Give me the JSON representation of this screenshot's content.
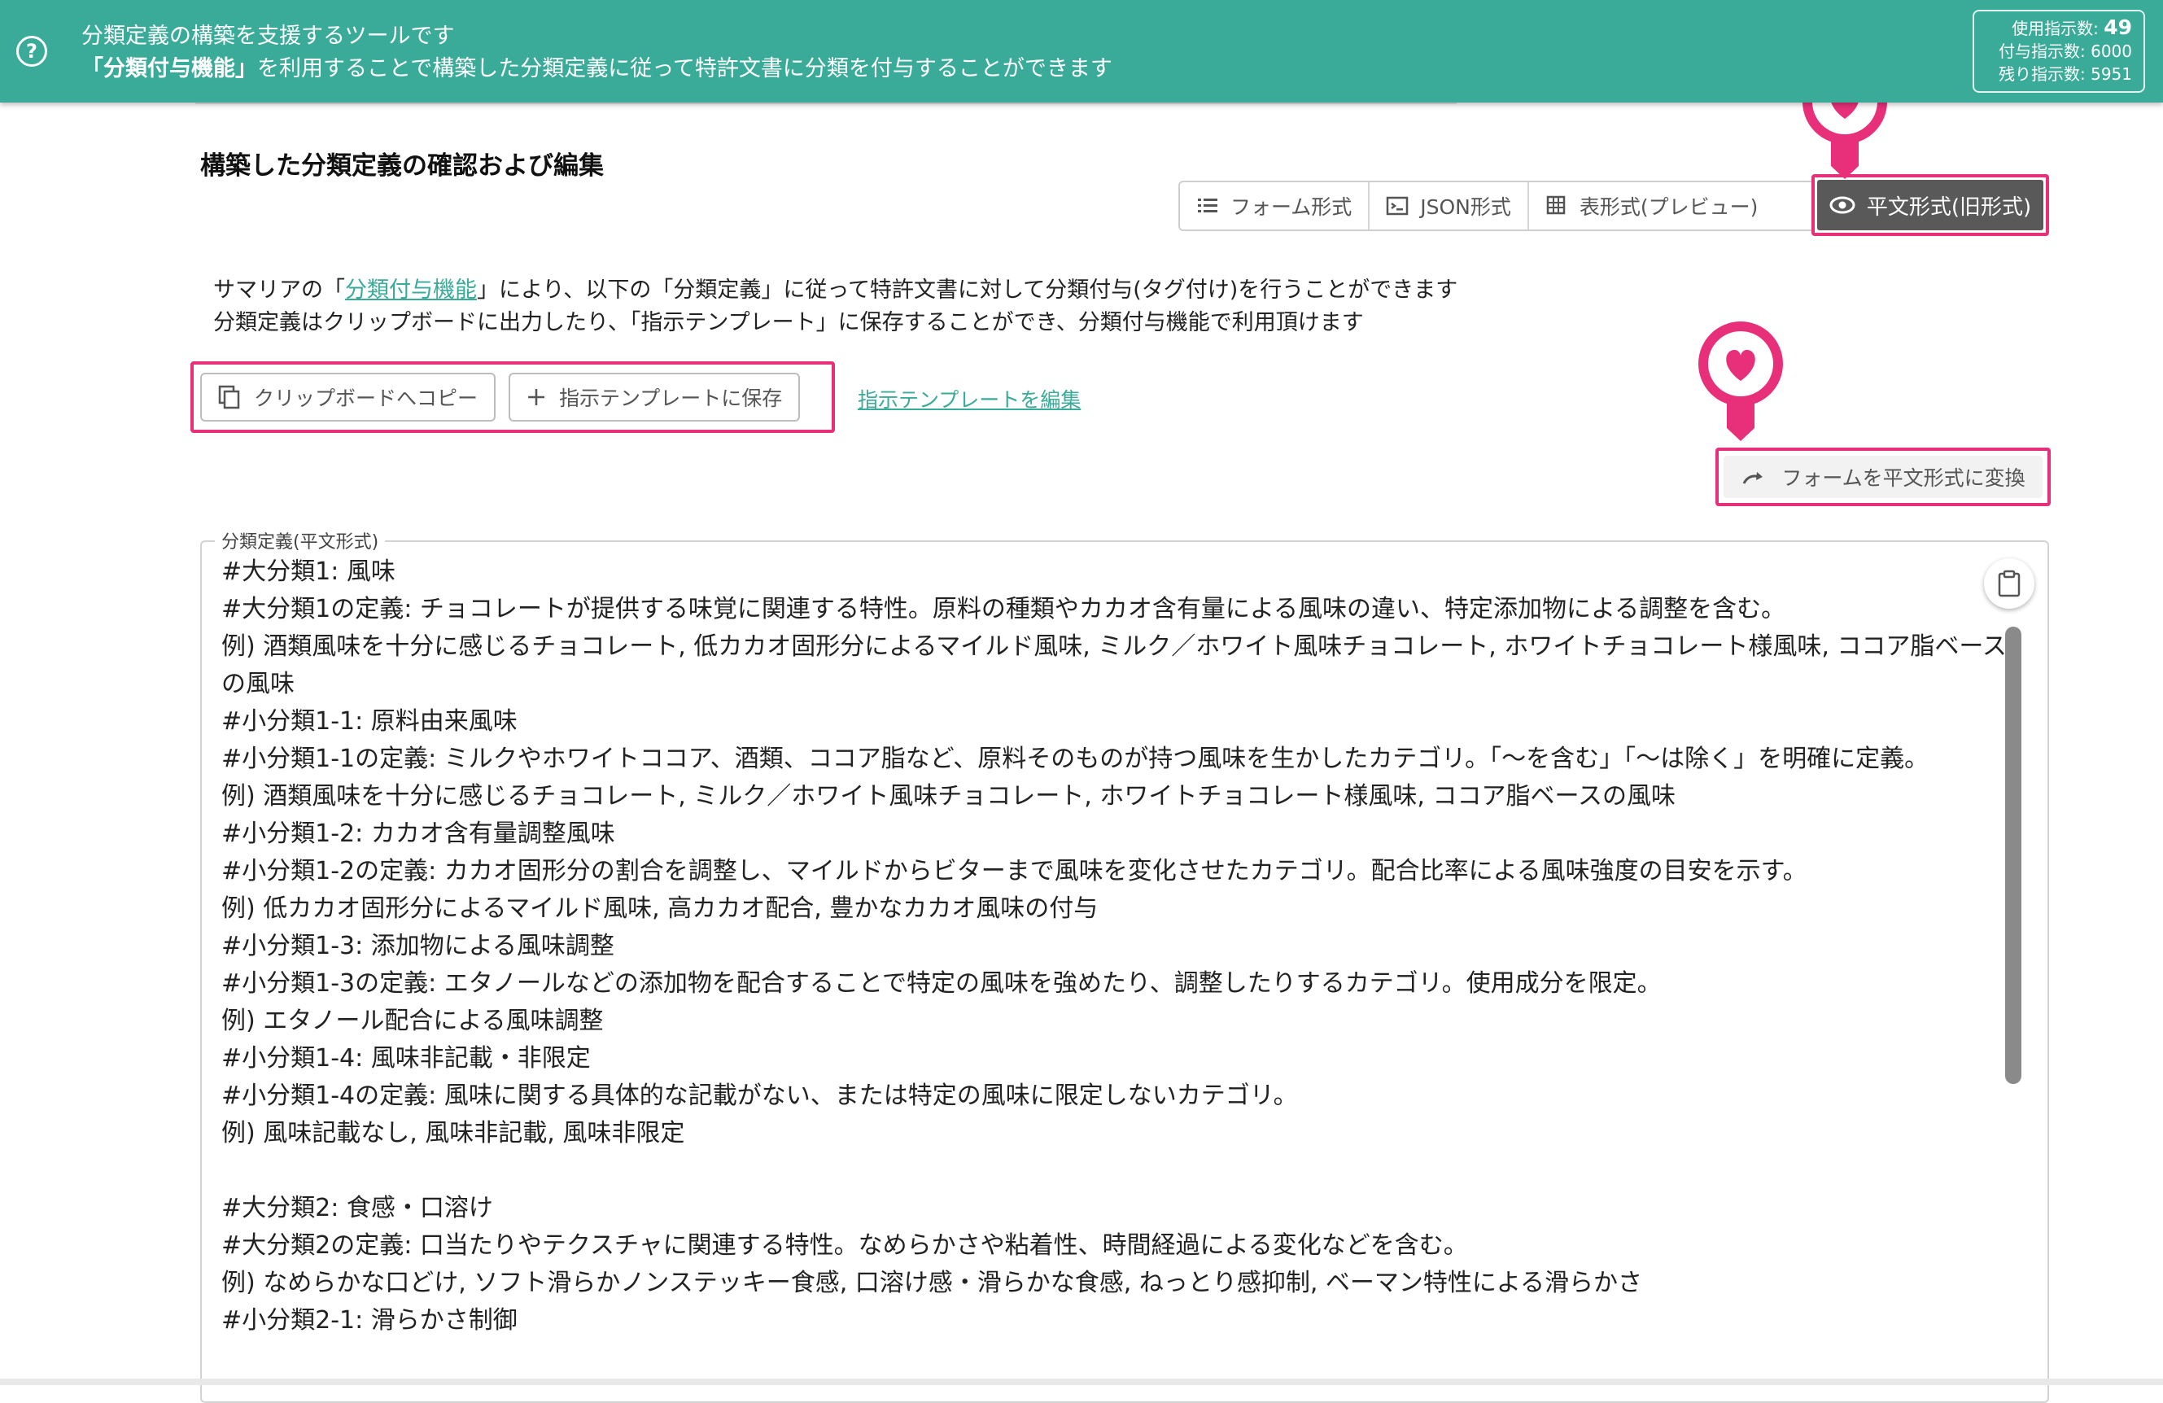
{
  "banner": {
    "line1": "分類定義の構築を支援するツールです",
    "line2_bold": "「分類付与機能」",
    "line2_rest": "を利用することで構築した分類定義に従って特許文書に分類を付与することができます",
    "counts": {
      "used_label": "使用指示数:",
      "used_value": "49",
      "granted_label": "付与指示数:",
      "granted_value": "6000",
      "remaining_label": "残り指示数:",
      "remaining_value": "5951"
    }
  },
  "section": {
    "title": "構築した分類定義の確認および編集"
  },
  "tabs": {
    "form": "フォーム形式",
    "json": "JSON形式",
    "table": "表形式(プレビュー)",
    "plain": "平文形式(旧形式)"
  },
  "description": {
    "line1_pre": "サマリアの「",
    "line1_link": "分類付与機能",
    "line1_post": "」により、以下の「分類定義」に従って特許文書に対して分類付与(タグ付け)を行うことができます",
    "line2": "分類定義はクリップボードに出力したり、「指示テンプレート」に保存することができ、分類付与機能で利用頂けます"
  },
  "actions": {
    "copy": "クリップボードへコピー",
    "save": "指示テンプレートに保存",
    "edit_link": "指示テンプレートを編集",
    "convert": "フォームを平文形式に変換"
  },
  "editor": {
    "legend": "分類定義(平文形式)",
    "lines": [
      "#大分類1: 風味",
      "#大分類1の定義: チョコレートが提供する味覚に関連する特性。原料の種類やカカオ含有量による風味の違い、特定添加物による調整を含む。",
      "例) 酒類風味を十分に感じるチョコレート, 低カカオ固形分によるマイルド風味, ミルク／ホワイト風味チョコレート, ホワイトチョコレート様風味, ココア脂ベースの風味",
      "#小分類1-1: 原料由来風味",
      "#小分類1-1の定義: ミルクやホワイトココア、酒類、ココア脂など、原料そのものが持つ風味を生かしたカテゴリ。「〜を含む」「〜は除く」を明確に定義。",
      "例) 酒類風味を十分に感じるチョコレート, ミルク／ホワイト風味チョコレート, ホワイトチョコレート様風味, ココア脂ベースの風味",
      "#小分類1-2: カカオ含有量調整風味",
      "#小分類1-2の定義: カカオ固形分の割合を調整し、マイルドからビターまで風味を変化させたカテゴリ。配合比率による風味強度の目安を示す。",
      "例) 低カカオ固形分によるマイルド風味, 高カカオ配合, 豊かなカカオ風味の付与",
      "#小分類1-3: 添加物による風味調整",
      "#小分類1-3の定義: エタノールなどの添加物を配合することで特定の風味を強めたり、調整したりするカテゴリ。使用成分を限定。",
      "例) エタノール配合による風味調整",
      "#小分類1-4: 風味非記載・非限定",
      "#小分類1-4の定義: 風味に関する具体的な記載がない、または特定の風味に限定しないカテゴリ。",
      "例) 風味記載なし, 風味非記載, 風味非限定",
      "",
      "#大分類2: 食感・口溶け",
      "#大分類2の定義: 口当たりやテクスチャに関連する特性。なめらかさや粘着性、時間経過による変化などを含む。",
      "例) なめらかな口どけ, ソフト滑らかノンステッキー食感, 口溶け感・滑らかな食感, ねっとり感抑制, ベーマン特性による滑らかさ",
      "#小分類2-1: 滑らかさ制御"
    ]
  },
  "colors": {
    "banner": "#3aab99",
    "highlight": "#e8307a",
    "link": "#3aab99",
    "active_tab": "#595959"
  }
}
